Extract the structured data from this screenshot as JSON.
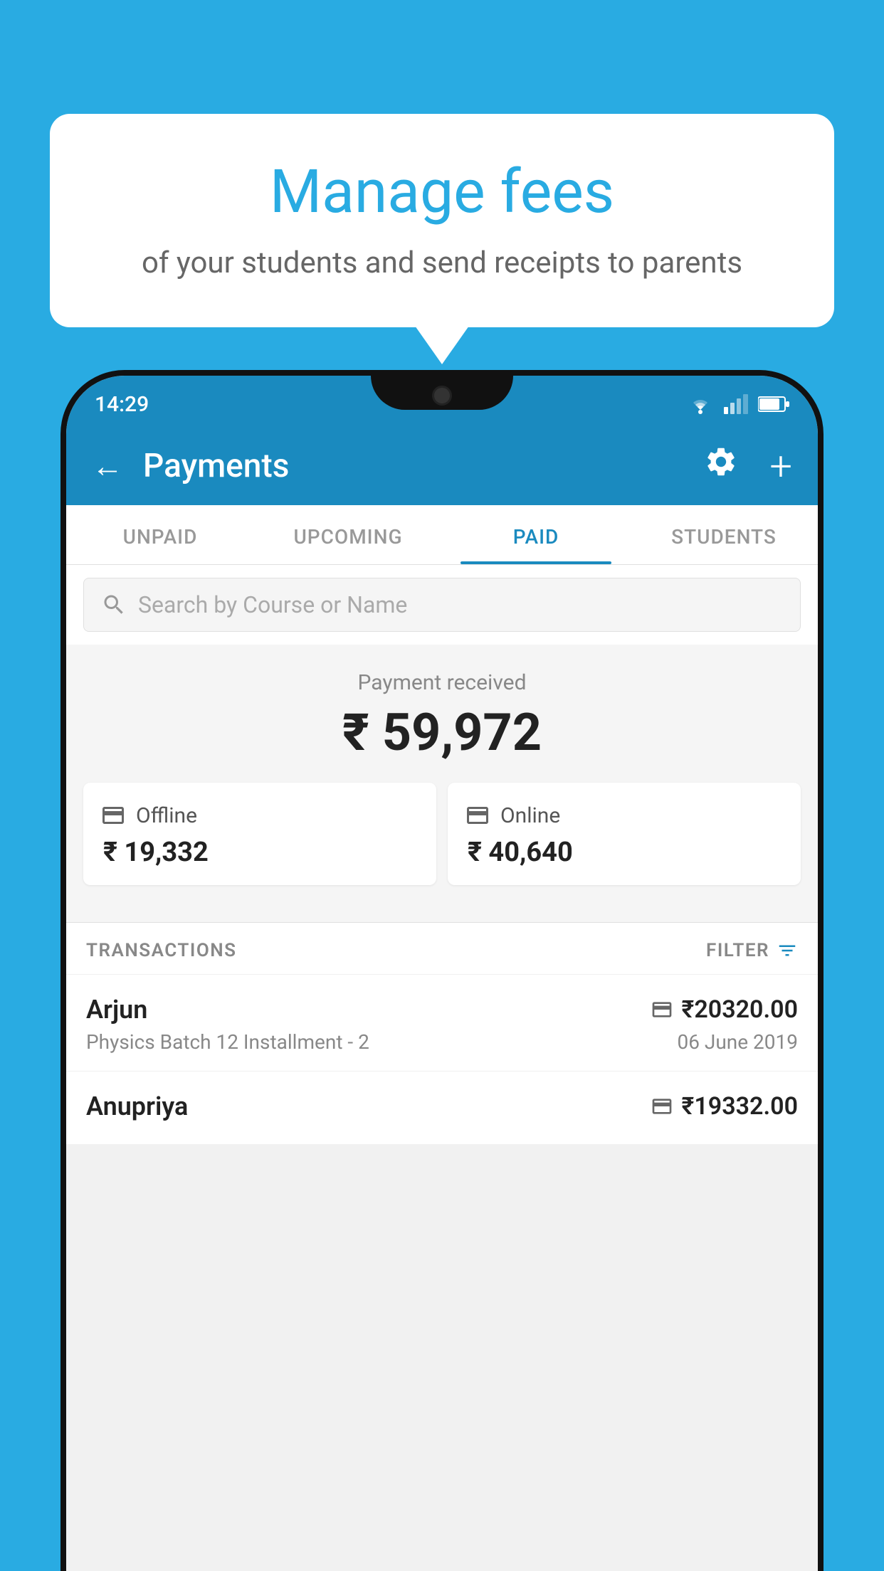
{
  "background_color": "#29abe2",
  "bubble": {
    "title": "Manage fees",
    "subtitle": "of your students and send receipts to parents"
  },
  "status_bar": {
    "time": "14:29",
    "wifi_icon": "▲",
    "signal_icon": "▲",
    "battery_icon": "▮"
  },
  "app_bar": {
    "title": "Payments",
    "back_label": "←",
    "settings_label": "⚙",
    "add_label": "+"
  },
  "tabs": [
    {
      "label": "UNPAID",
      "active": false
    },
    {
      "label": "UPCOMING",
      "active": false
    },
    {
      "label": "PAID",
      "active": true
    },
    {
      "label": "STUDENTS",
      "active": false
    }
  ],
  "search": {
    "placeholder": "Search by Course or Name"
  },
  "payment_received": {
    "label": "Payment received",
    "amount": "₹ 59,972",
    "offline": {
      "label": "Offline",
      "amount": "₹ 19,332"
    },
    "online": {
      "label": "Online",
      "amount": "₹ 40,640"
    }
  },
  "transactions": {
    "section_label": "TRANSACTIONS",
    "filter_label": "FILTER",
    "rows": [
      {
        "name": "Arjun",
        "amount": "₹20320.00",
        "course": "Physics Batch 12 Installment - 2",
        "date": "06 June 2019",
        "payment_type": "online"
      },
      {
        "name": "Anupriya",
        "amount": "₹19332.00",
        "course": "",
        "date": "",
        "payment_type": "offline"
      }
    ]
  }
}
